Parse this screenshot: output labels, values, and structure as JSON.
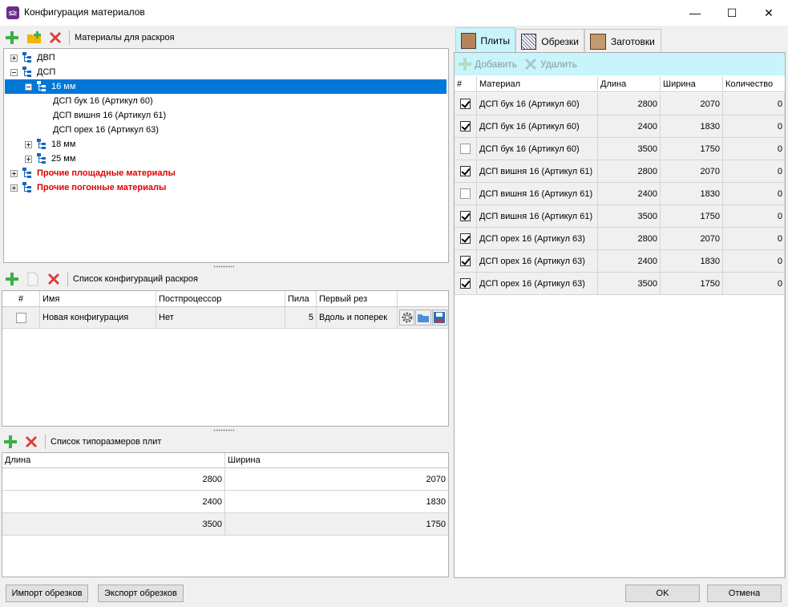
{
  "window": {
    "title": "Конфигурация материалов",
    "app_icon_glyph": "≤≥",
    "minimize_glyph": "—",
    "maximize_glyph": "☐",
    "close_glyph": "✕"
  },
  "materials_panel": {
    "title": "Материалы для раскроя",
    "tree": [
      {
        "label": "ДВП",
        "level": 0,
        "expander": "plus",
        "style": "normal"
      },
      {
        "label": "ДСП",
        "level": 0,
        "expander": "minus",
        "style": "normal"
      },
      {
        "label": "16 мм",
        "level": 1,
        "expander": "minus",
        "style": "selected"
      },
      {
        "label": "ДСП бук 16 (Артикул 60)",
        "level": 2,
        "expander": "none",
        "style": "normal"
      },
      {
        "label": "ДСП вишня 16 (Артикул 61)",
        "level": 2,
        "expander": "none",
        "style": "normal"
      },
      {
        "label": "ДСП орех 16 (Артикул 63)",
        "level": 2,
        "expander": "none",
        "style": "normal"
      },
      {
        "label": "18 мм",
        "level": 1,
        "expander": "plus",
        "style": "normal"
      },
      {
        "label": "25 мм",
        "level": 1,
        "expander": "plus",
        "style": "normal"
      },
      {
        "label": "Прочие площадные материалы",
        "level": 0,
        "expander": "plus",
        "style": "red"
      },
      {
        "label": "Прочие погонные материалы",
        "level": 0,
        "expander": "plus",
        "style": "red"
      }
    ]
  },
  "configs_panel": {
    "title": "Список конфигураций раскроя",
    "columns": [
      "#",
      "Имя",
      "Постпроцессор",
      "Пила",
      "Первый рез"
    ],
    "rows": [
      {
        "checked": false,
        "name": "Новая конфигурация",
        "postprocessor": "Нет",
        "saw": "5",
        "first_cut": "Вдоль и поперек"
      }
    ]
  },
  "sizes_panel": {
    "title": "Список типоразмеров плит",
    "columns": [
      "Длина",
      "Ширина"
    ],
    "rows": [
      {
        "length": "2800",
        "width": "2070"
      },
      {
        "length": "2400",
        "width": "1830"
      },
      {
        "length": "3500",
        "width": "1750"
      }
    ]
  },
  "tabs": [
    {
      "label": "Плиты",
      "active": true
    },
    {
      "label": "Обрезки",
      "active": false
    },
    {
      "label": "Заготовки",
      "active": false
    }
  ],
  "sheets_toolbar": {
    "add_label": "Добавить",
    "delete_label": "Удалить"
  },
  "sheets_grid": {
    "columns": [
      "#",
      "Материал",
      "Длина",
      "Ширина",
      "Количество"
    ],
    "rows": [
      {
        "checked": true,
        "material": "ДСП бук 16 (Артикул 60)",
        "length": "2800",
        "width": "2070",
        "qty": "0"
      },
      {
        "checked": true,
        "material": "ДСП бук 16 (Артикул 60)",
        "length": "2400",
        "width": "1830",
        "qty": "0"
      },
      {
        "checked": false,
        "material": "ДСП бук 16 (Артикул 60)",
        "length": "3500",
        "width": "1750",
        "qty": "0"
      },
      {
        "checked": true,
        "material": "ДСП вишня 16 (Артикул 61)",
        "length": "2800",
        "width": "2070",
        "qty": "0"
      },
      {
        "checked": false,
        "material": "ДСП вишня 16 (Артикул 61)",
        "length": "2400",
        "width": "1830",
        "qty": "0"
      },
      {
        "checked": true,
        "material": "ДСП вишня 16 (Артикул 61)",
        "length": "3500",
        "width": "1750",
        "qty": "0"
      },
      {
        "checked": true,
        "material": "ДСП орех 16 (Артикул 63)",
        "length": "2800",
        "width": "2070",
        "qty": "0"
      },
      {
        "checked": true,
        "material": "ДСП орех 16 (Артикул 63)",
        "length": "2400",
        "width": "1830",
        "qty": "0"
      },
      {
        "checked": true,
        "material": "ДСП орех 16 (Артикул 63)",
        "length": "3500",
        "width": "1750",
        "qty": "0"
      }
    ]
  },
  "footer": {
    "import_label": "Импорт обрезков",
    "export_label": "Экспорт обрезков",
    "ok_label": "OK",
    "cancel_label": "Отмена"
  },
  "colors": {
    "selection": "#0078d7",
    "tab_active": "#c8f4fb",
    "toolbar_strip": "#c8f4fb",
    "red_text": "#e00000",
    "add_green": "#3cb043",
    "delete_red": "#e53935"
  }
}
